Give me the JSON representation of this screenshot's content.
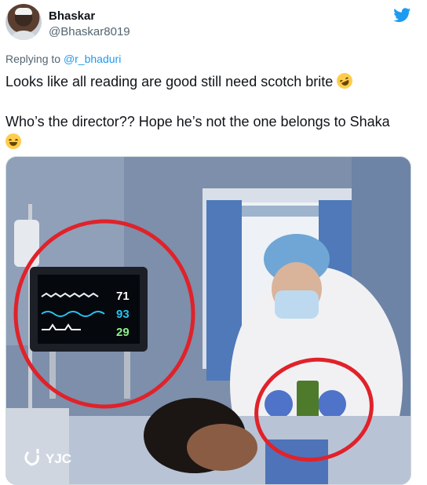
{
  "author": {
    "display_name": "Bhaskar",
    "handle": "@Bhaskar8019"
  },
  "reply": {
    "prefix": "Replying to ",
    "mention": "@r_bhaduri"
  },
  "tweet": {
    "line1": "Looks like all reading are good still need scotch brite",
    "line2": "Who’s the director?? Hope he’s not the one belongs to Shaka"
  },
  "media": {
    "monitor": {
      "value_top": "71",
      "value_mid": "93",
      "value_bottom": "29"
    },
    "watermark": "YJC"
  },
  "icons": {
    "brand": "twitter-bird-icon",
    "emoji1": "rolling-on-the-floor-laughing-emoji",
    "emoji2": "face-with-tears-of-joy-emoji"
  },
  "colors": {
    "accent": "#1d9bf0",
    "secondary_text": "#536471",
    "annotation_circle": "#e0222a"
  }
}
